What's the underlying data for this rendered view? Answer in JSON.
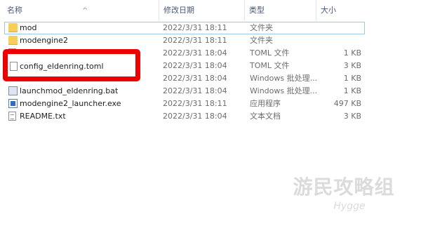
{
  "header": {
    "name": "名称",
    "date": "修改日期",
    "type": "类型",
    "size": "大小",
    "sort_indicator": "^"
  },
  "files": [
    {
      "name": "mod",
      "date": "2022/3/31 18:11",
      "type": "文件夹",
      "size": "",
      "icon": "folder-icon"
    },
    {
      "name": "modengine2",
      "date": "2022/3/31 18:11",
      "type": "文件夹",
      "size": "",
      "icon": "folder-icon"
    },
    {
      "name": "",
      "date": "2022/3/31 18:04",
      "type": "TOML 文件",
      "size": "1 KB",
      "icon": "toml-file-icon"
    },
    {
      "name": "",
      "date": "2022/3/31 18:04",
      "type": "TOML 文件",
      "size": "3 KB",
      "icon": "toml-file-icon"
    },
    {
      "name": "",
      "date": "2022/3/31 18:04",
      "type": "Windows 批处理...",
      "size": "1 KB",
      "icon": "batch-file-icon"
    },
    {
      "name": "launchmod_eldenring.bat",
      "date": "2022/3/31 18:04",
      "type": "Windows 批处理...",
      "size": "1 KB",
      "icon": "batch-file-icon"
    },
    {
      "name": "modengine2_launcher.exe",
      "date": "2022/3/31 18:11",
      "type": "应用程序",
      "size": "497 KB",
      "icon": "exe-file-icon"
    },
    {
      "name": "README.txt",
      "date": "2022/3/31 18:04",
      "type": "文本文档",
      "size": "3 KB",
      "icon": "text-file-icon"
    }
  ],
  "highlight": {
    "name": "config_eldenring.toml",
    "icon": "toml-file-icon",
    "color": "#ee0000"
  },
  "watermark": {
    "main": "游民攻略组",
    "sub": "Hygge"
  }
}
